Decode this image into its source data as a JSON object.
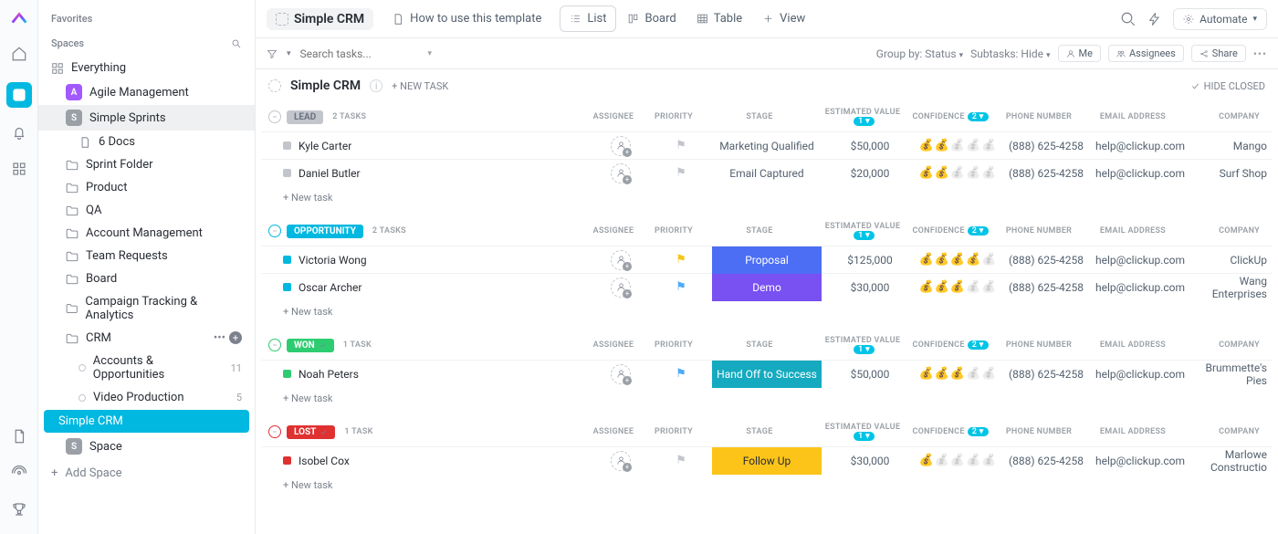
{
  "rail": {
    "items": [
      "home",
      "tasks",
      "notifications",
      "apps"
    ],
    "bottom": [
      "doc",
      "pulse",
      "trophy"
    ]
  },
  "sidebar": {
    "favorites_label": "Favorites",
    "spaces_label": "Spaces",
    "everything_label": "Everything",
    "items": [
      {
        "label": "Agile Management",
        "icon": "badge",
        "color": "#a259ff"
      },
      {
        "label": "Simple Sprints",
        "icon": "badge",
        "color": "#9aa0a6",
        "selected": true
      },
      {
        "label": "6 Docs",
        "icon": "doc",
        "indent": 2
      },
      {
        "label": "Sprint Folder",
        "icon": "folder",
        "color": "#292d34"
      },
      {
        "label": "Product",
        "icon": "folder",
        "color": "#292d34"
      },
      {
        "label": "QA",
        "icon": "folder",
        "color": "#292d34"
      },
      {
        "label": "Account Management",
        "icon": "folder",
        "color": "#292d34"
      },
      {
        "label": "Team Requests",
        "icon": "folder",
        "color": "#292d34"
      },
      {
        "label": "Board",
        "icon": "folder",
        "color": "#b02a2a"
      },
      {
        "label": "Campaign Tracking & Analytics",
        "icon": "folder",
        "color": "#f5c518"
      },
      {
        "label": "CRM",
        "icon": "folder",
        "color": "#292d34",
        "actions": true
      },
      {
        "label": "Accounts & Opportunities",
        "icon": "list",
        "indent": 2,
        "count": "11"
      },
      {
        "label": "Video Production",
        "icon": "list",
        "indent": 2,
        "count": "5"
      },
      {
        "label": "Simple CRM",
        "icon": "none",
        "active_crm": true
      },
      {
        "label": "Space",
        "icon": "badge",
        "color": "#9aa0a6"
      }
    ],
    "add_label": "Add Space"
  },
  "header": {
    "title": "Simple CRM",
    "template_link": "How to use this template",
    "views": [
      {
        "label": "List",
        "active": true,
        "icon": "list"
      },
      {
        "label": "Board",
        "icon": "board"
      },
      {
        "label": "Table",
        "icon": "table"
      },
      {
        "label": "View",
        "icon": "plus"
      }
    ],
    "automate_label": "Automate"
  },
  "filters": {
    "search_placeholder": "Search tasks...",
    "group_by": "Group by: Status",
    "subtasks": "Subtasks: Hide",
    "me": "Me",
    "assignees": "Assignees",
    "share": "Share"
  },
  "board": {
    "title": "Simple CRM",
    "new_task_label": "+ NEW TASK",
    "hide_closed": "HIDE CLOSED"
  },
  "columns": [
    "ASSIGNEE",
    "PRIORITY",
    "STAGE",
    "ESTIMATED VALUE",
    "CONFIDENCE",
    "PHONE NUMBER",
    "EMAIL ADDRESS",
    "COMPANY"
  ],
  "col_badges": {
    "est": "1",
    "conf": "2"
  },
  "groups": [
    {
      "status": "LEAD",
      "color": "#c2c6cc",
      "text_color": "#6b7280",
      "circle": "#c2c6cc",
      "count": "2 TASKS",
      "check": false,
      "tasks": [
        {
          "name": "Kyle Carter",
          "dot": "#c2c6cc",
          "stage": "Marketing Qualified",
          "stage_bg": "",
          "est": "$50,000",
          "conf": 2,
          "phone": "(888) 625-4258",
          "email": "help@clickup.com",
          "company": "Mango",
          "flag": "#c2c6cc"
        },
        {
          "name": "Daniel Butler",
          "dot": "#c2c6cc",
          "stage": "Email Captured",
          "stage_bg": "",
          "est": "$20,000",
          "conf": 2,
          "phone": "(888) 625-4258",
          "email": "help@clickup.com",
          "company": "Surf Shop",
          "flag": "#c2c6cc"
        }
      ]
    },
    {
      "status": "OPPORTUNITY",
      "color": "#00b8e0",
      "circle": "#00b8e0",
      "count": "2 TASKS",
      "check": false,
      "tasks": [
        {
          "name": "Victoria Wong",
          "dot": "#00b8e0",
          "stage": "Proposal",
          "stage_bg": "#4c6ef5",
          "stage_fg": "#fff",
          "est": "$125,000",
          "conf": 4,
          "phone": "(888) 625-4258",
          "email": "help@clickup.com",
          "company": "ClickUp",
          "flag": "#f5c518"
        },
        {
          "name": "Oscar Archer",
          "dot": "#00b8e0",
          "stage": "Demo",
          "stage_bg": "#7950f2",
          "stage_fg": "#fff",
          "est": "$30,000",
          "conf": 3,
          "phone": "(888) 625-4258",
          "email": "help@clickup.com",
          "company": "Wang Enterprises",
          "flag": "#4dabf7"
        }
      ]
    },
    {
      "status": "WON",
      "color": "#2ecc71",
      "circle": "#2ecc71",
      "count": "1 TASK",
      "check": true,
      "tasks": [
        {
          "name": "Noah Peters",
          "dot": "#2ecc71",
          "stage": "Hand Off to Success",
          "stage_bg": "#15aabf",
          "stage_fg": "#fff",
          "est": "$50,000",
          "conf": 3,
          "phone": "(888) 625-4258",
          "email": "help@clickup.com",
          "company": "Brummette's Pies",
          "flag": "#4dabf7"
        }
      ]
    },
    {
      "status": "LOST",
      "color": "#e03131",
      "circle": "#e03131",
      "count": "1 TASK",
      "check": true,
      "tasks": [
        {
          "name": "Isobel Cox",
          "dot": "#e03131",
          "stage": "Follow Up",
          "stage_bg": "#fcc419",
          "stage_fg": "#292d34",
          "est": "$30,000",
          "conf": 1,
          "phone": "(888) 625-4258",
          "email": "help@clickup.com",
          "company": "Marlowe Constructio",
          "flag": "#c2c6cc"
        }
      ]
    }
  ],
  "new_task_row": "+ New task"
}
